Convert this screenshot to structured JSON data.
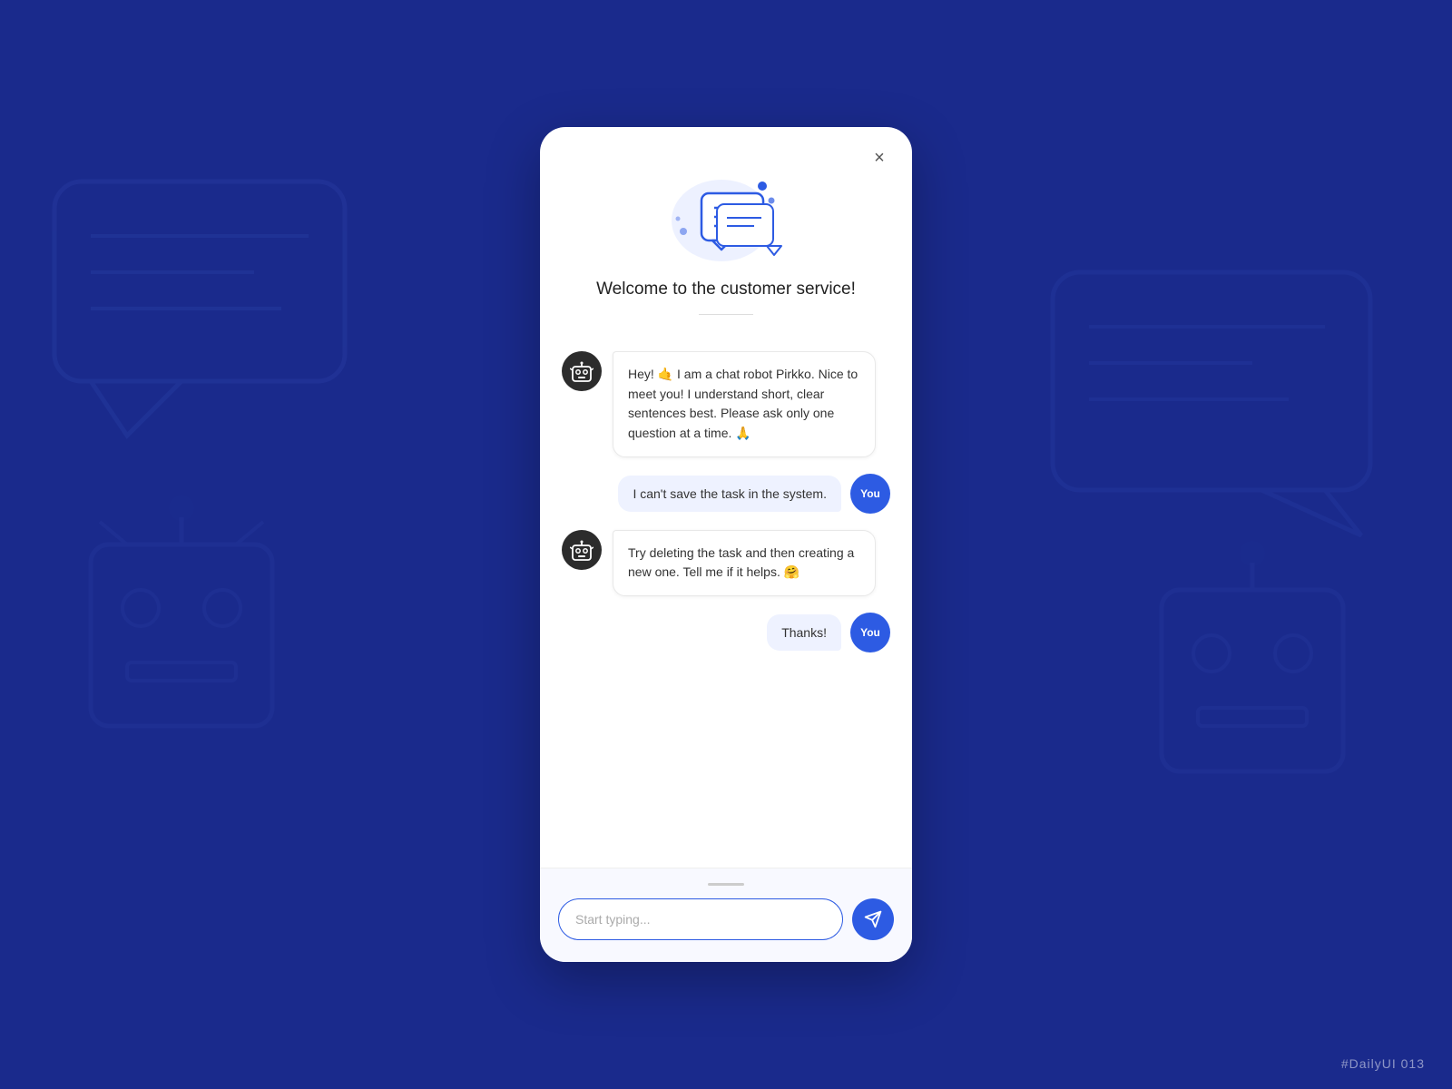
{
  "background": {
    "color": "#1a2a8c"
  },
  "daily_ui_tag": "#DailyUI 013",
  "modal": {
    "close_label": "×",
    "welcome_icon_alt": "chat-bubbles-icon",
    "welcome_title": "Welcome to the customer service!",
    "messages": [
      {
        "id": "bot-1",
        "sender": "bot",
        "text": "Hey! 🤙 I am a chat robot Pirkko. Nice to meet you! I understand short, clear sentences best. Please ask only one question at a time. 🙏"
      },
      {
        "id": "user-1",
        "sender": "user",
        "text": "I can't save the task in the system.",
        "avatar_label": "You"
      },
      {
        "id": "bot-2",
        "sender": "bot",
        "text": "Try deleting the task and then creating a new one. Tell me if it helps. 🤗"
      },
      {
        "id": "user-2",
        "sender": "user",
        "text": "Thanks!",
        "avatar_label": "You"
      }
    ],
    "input": {
      "placeholder": "Start typing...",
      "value": ""
    },
    "send_button_label": "send"
  }
}
